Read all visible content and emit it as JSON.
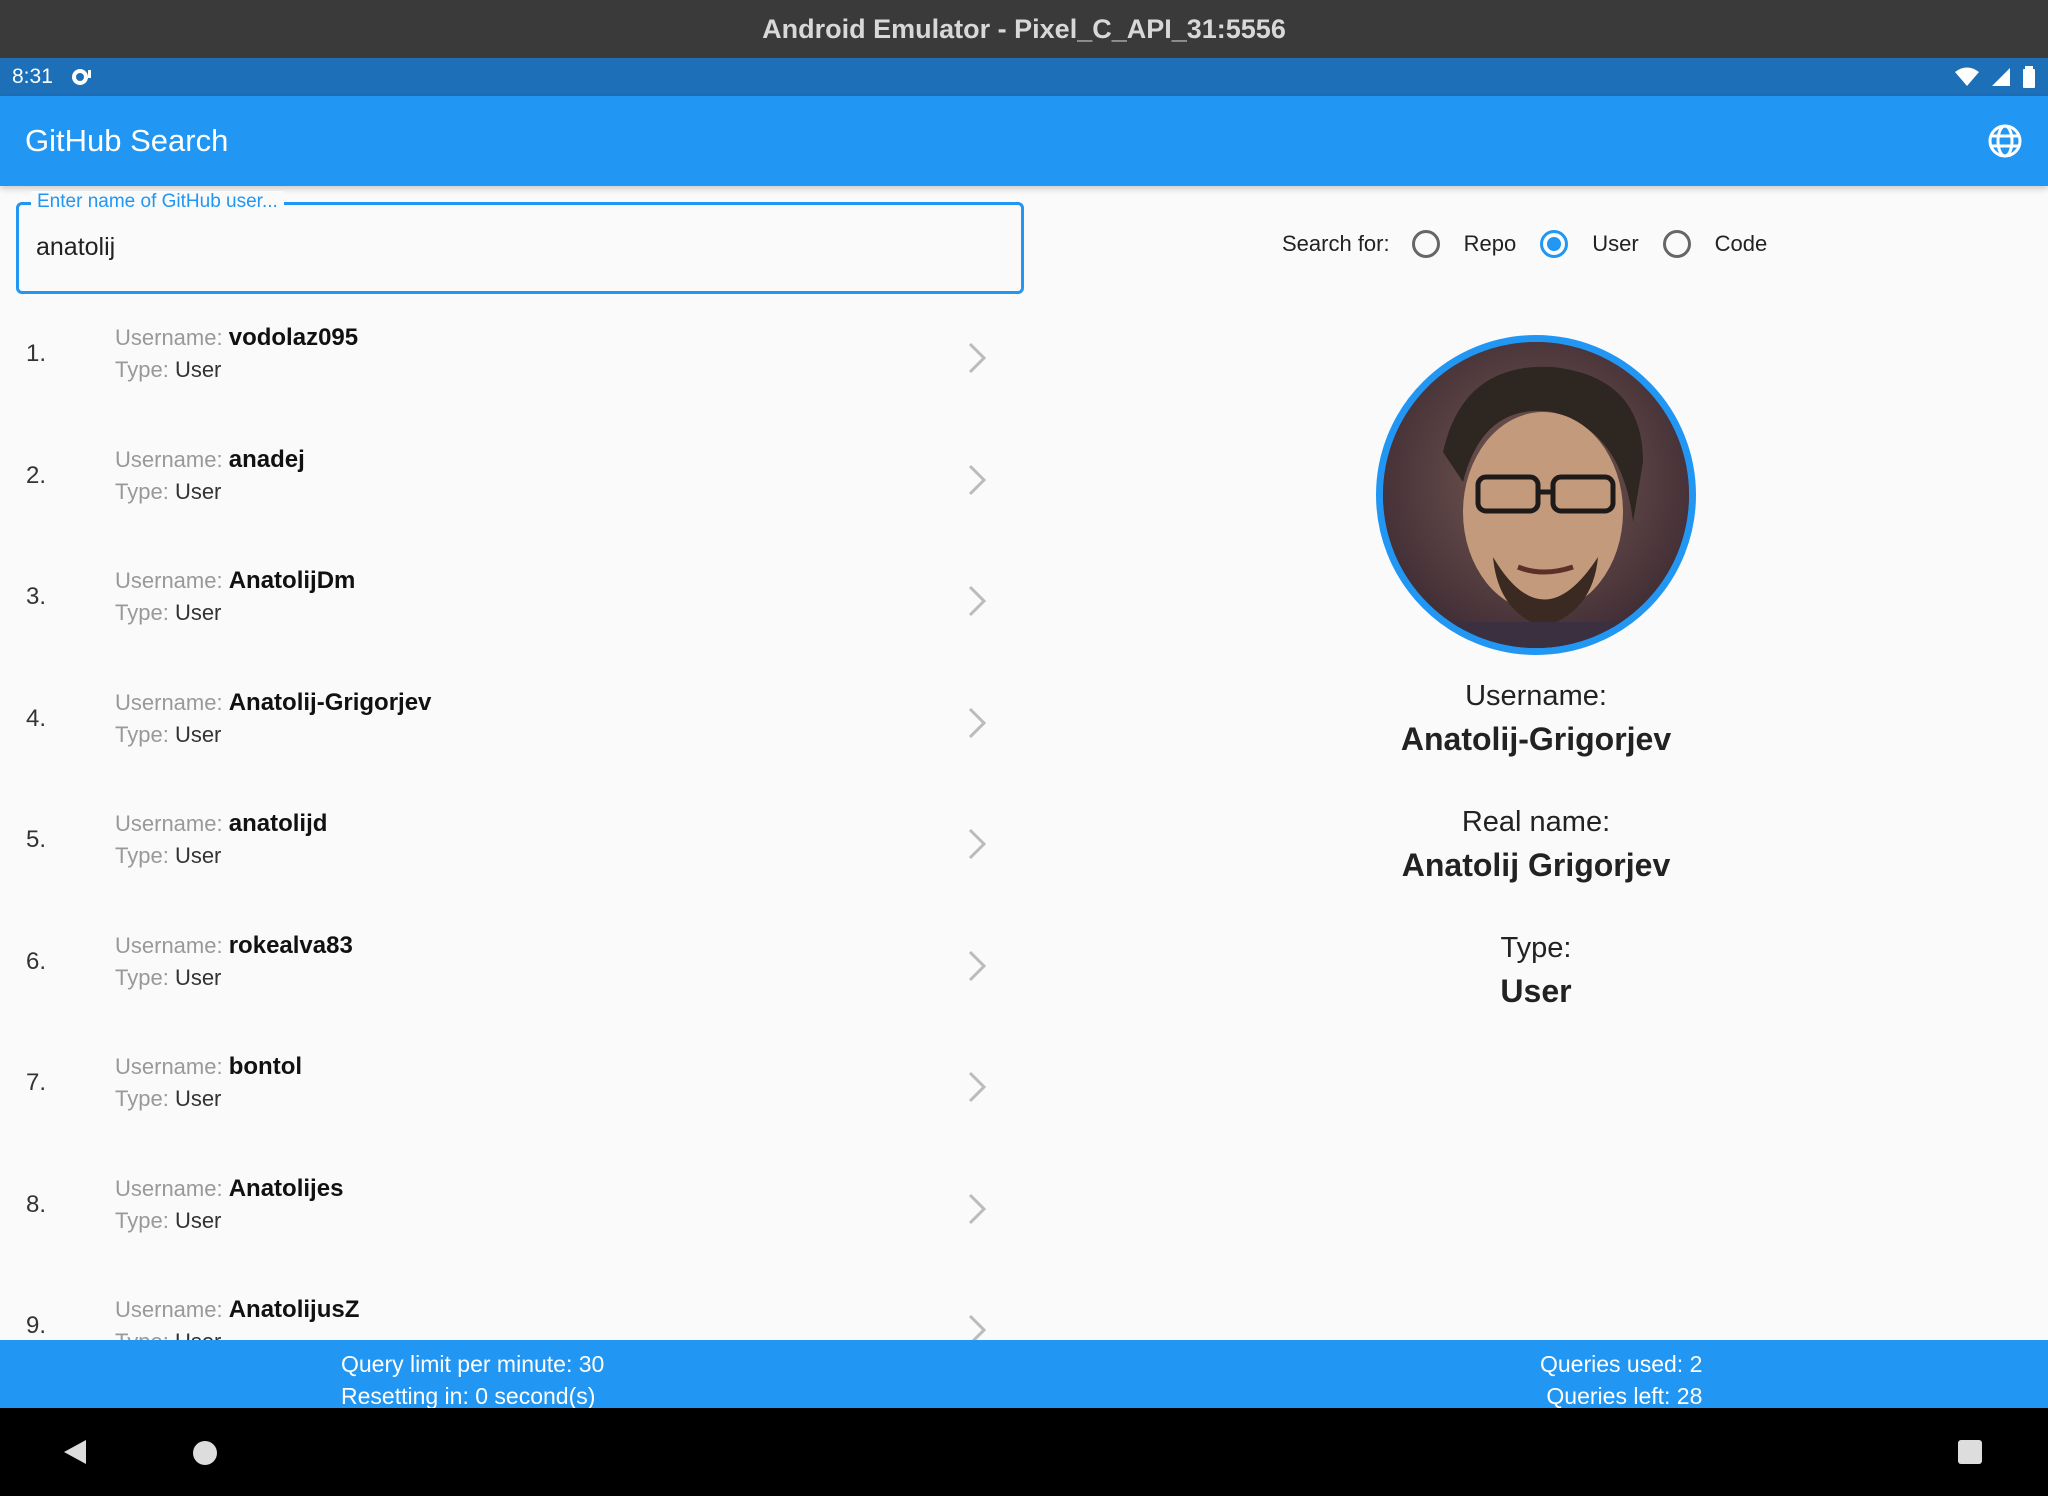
{
  "window": {
    "title": "Android Emulator - Pixel_C_API_31:5556"
  },
  "status_bar": {
    "time": "8:31"
  },
  "app_bar": {
    "title": "GitHub Search"
  },
  "search": {
    "label": "Enter name of GitHub user...",
    "value": "anatolij"
  },
  "search_for": {
    "label": "Search for:",
    "options": [
      {
        "label": "Repo",
        "selected": false
      },
      {
        "label": "User",
        "selected": true
      },
      {
        "label": "Code",
        "selected": false
      }
    ]
  },
  "results": {
    "username_label": "Username:",
    "type_label": "Type:",
    "items": [
      {
        "num": "1.",
        "username": "vodolaz095",
        "type": "User"
      },
      {
        "num": "2.",
        "username": "anadej",
        "type": "User"
      },
      {
        "num": "3.",
        "username": "AnatolijDm",
        "type": "User"
      },
      {
        "num": "4.",
        "username": "Anatolij-Grigorjev",
        "type": "User"
      },
      {
        "num": "5.",
        "username": "anatolijd",
        "type": "User"
      },
      {
        "num": "6.",
        "username": "rokealva83",
        "type": "User"
      },
      {
        "num": "7.",
        "username": "bontol",
        "type": "User"
      },
      {
        "num": "8.",
        "username": "Anatolijes",
        "type": "User"
      },
      {
        "num": "9.",
        "username": "AnatolijusZ",
        "type": "User"
      }
    ]
  },
  "detail": {
    "username_label": "Username:",
    "username": "Anatolij-Grigorjev",
    "realname_label": "Real name:",
    "realname": "Anatolij Grigorjev",
    "type_label": "Type:",
    "type": "User"
  },
  "footer": {
    "limit": "Query limit per minute: 30",
    "resetting": "Resetting in: 0 second(s)",
    "used": "Queries used: 2",
    "left": "Queries left: 28"
  },
  "colors": {
    "primary": "#2196f3",
    "status_bar": "#1d6fb8",
    "title_bar": "#3a3a3a"
  }
}
